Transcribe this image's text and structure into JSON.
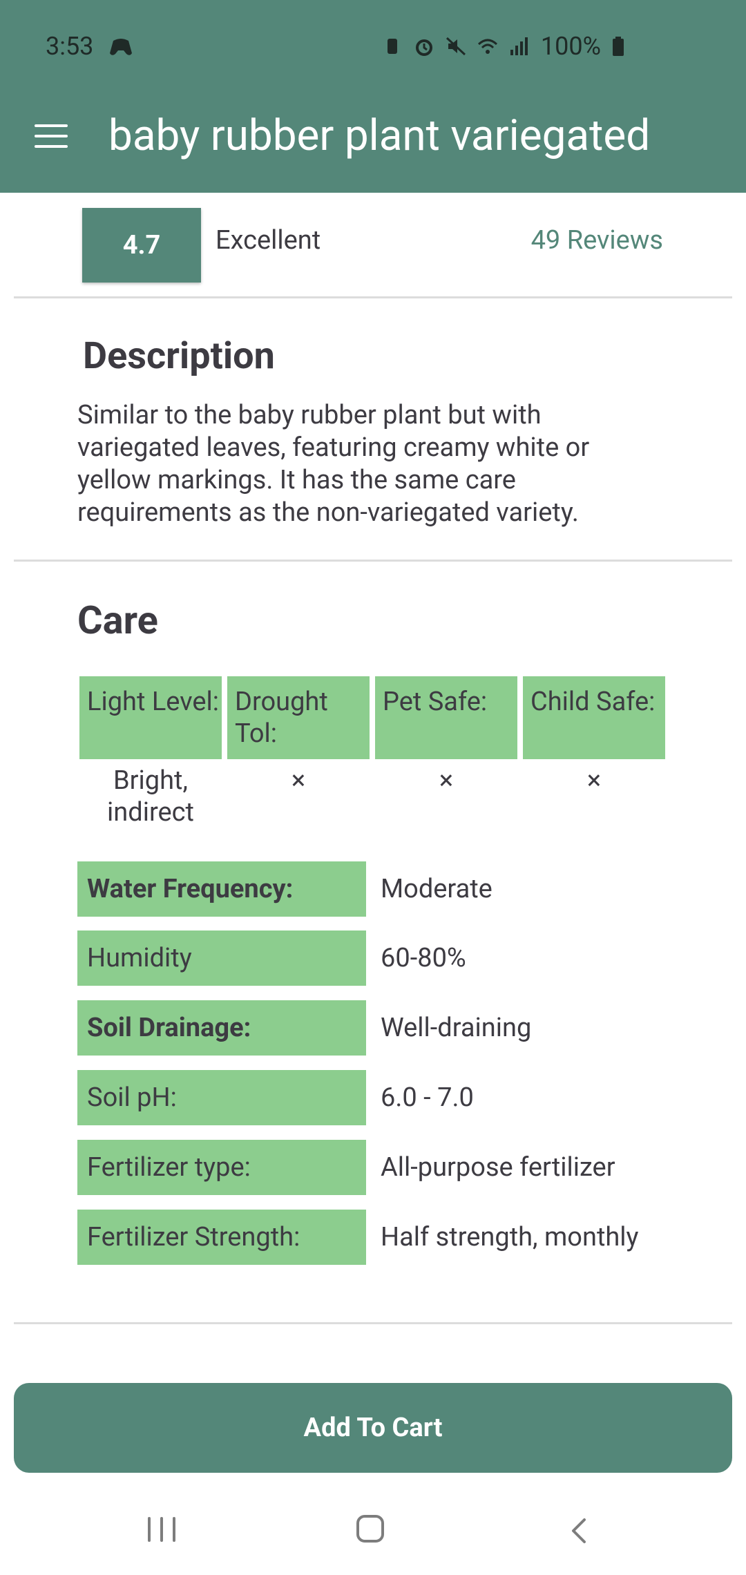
{
  "status_bar": {
    "time": "3:53",
    "battery": "100%"
  },
  "app_bar": {
    "title": "baby rubber plant variegated"
  },
  "rating": {
    "score": "4.7",
    "label": "Excellent",
    "reviews": "49 Reviews"
  },
  "description": {
    "heading": "Description",
    "text": "Similar to the baby rubber plant but with variegated leaves, featuring creamy white or yellow markings. It has the same care requirements as the non-variegated variety."
  },
  "care": {
    "heading": "Care",
    "grid": [
      {
        "label": "Light Level:",
        "value": "Bright, indirect"
      },
      {
        "label": "Drought Tol:",
        "value": "×"
      },
      {
        "label": "Pet Safe:",
        "value": "×"
      },
      {
        "label": "Child Safe:",
        "value": "×"
      }
    ],
    "table": [
      {
        "key": "Water Frequency:",
        "value": "Moderate"
      },
      {
        "key": "Humidity",
        "value": "60-80%"
      },
      {
        "key": "Soil Drainage:",
        "value": "Well-draining"
      },
      {
        "key": "Soil pH:",
        "value": "6.0 - 7.0"
      },
      {
        "key": "Fertilizer type:",
        "value": "All-purpose fertilizer"
      },
      {
        "key": "Fertilizer Strength:",
        "value": "Half strength, monthly"
      }
    ]
  },
  "actions": {
    "add_to_cart": "Add To Cart"
  },
  "colors": {
    "primary": "#548779",
    "accent_green": "#8ccd8e",
    "text": "#3d3b42"
  },
  "icons": [
    "menu-icon",
    "game-controller-icon",
    "alarm-icon",
    "mute-icon",
    "wifi-icon",
    "signal-icon",
    "battery-icon",
    "recent-apps-icon",
    "home-icon",
    "back-icon"
  ]
}
